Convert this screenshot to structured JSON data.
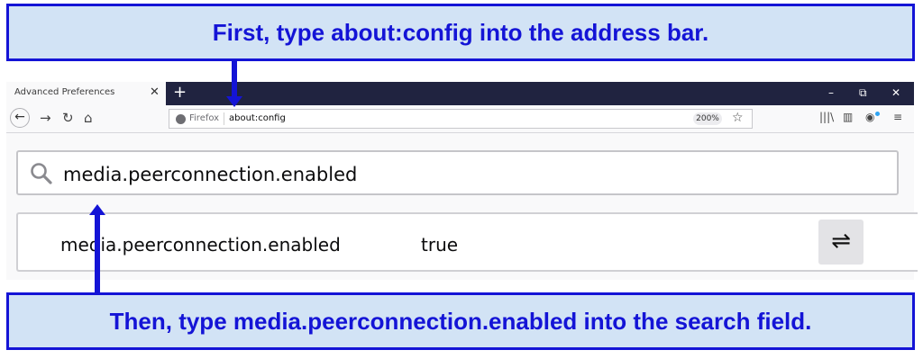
{
  "annotations": {
    "top": "First, type about:config into the address bar.",
    "bottom": "Then, type media.peerconnection.enabled into the search field."
  },
  "browser": {
    "tab": {
      "title": "Advanced Preferences",
      "close": "✕"
    },
    "new_tab": "+",
    "window_controls": {
      "minimize": "–",
      "restore": "⧉",
      "close": "✕"
    },
    "nav": {
      "back": "←",
      "forward": "→",
      "reload": "↻",
      "home": "⌂"
    },
    "urlbar": {
      "identity": "Firefox",
      "url": "about:config",
      "zoom": "200%",
      "bookmark": "☆"
    },
    "toolbar": {
      "library": "|||\\",
      "sidebar": "▥",
      "account": "◉",
      "menu": "≡"
    }
  },
  "config": {
    "search": {
      "value": "media.peerconnection.enabled"
    },
    "rows": [
      {
        "name": "media.peerconnection.enabled",
        "value": "true",
        "action_icon": "⇌"
      }
    ]
  },
  "icons": {
    "search": "search-icon",
    "toggle": "toggle-arrows-icon",
    "firefox": "firefox-icon"
  },
  "colors": {
    "annotation_bg": "#d2e3f5",
    "annotation_border": "#1414d6",
    "annotation_text": "#1414d6",
    "tabbar_bg": "#202340"
  }
}
